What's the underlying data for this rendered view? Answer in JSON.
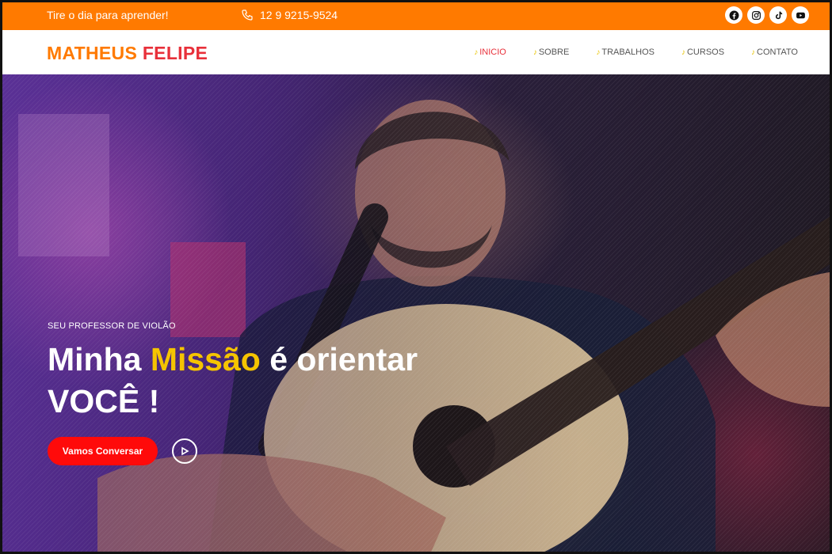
{
  "topbar": {
    "tagline": "Tire o dia para aprender!",
    "phone": "12 9 9215-9524",
    "socials": [
      {
        "icon": "facebook-icon"
      },
      {
        "icon": "instagram-icon"
      },
      {
        "icon": "tiktok-icon"
      },
      {
        "icon": "youtube-icon"
      }
    ],
    "color": "#ff7a00"
  },
  "header": {
    "logo_first": "MATHEUS",
    "logo_last": "FELIPE",
    "nav": [
      {
        "label": "INICIO",
        "active": true
      },
      {
        "label": "SOBRE",
        "active": false
      },
      {
        "label": "TRABALHOS",
        "active": false
      },
      {
        "label": "CURSOS",
        "active": false
      },
      {
        "label": "CONTATO",
        "active": false
      }
    ]
  },
  "hero": {
    "eyebrow": "SEU PROFESSOR DE VIOLÃO",
    "headline_part1": "Minha ",
    "headline_accent": "Missão",
    "headline_part2": " é orientar",
    "headline_line2": "VOCÊ !",
    "cta_label": "Vamos Conversar",
    "cta_color": "#ff0a0a",
    "accent_color": "#f5c400"
  }
}
